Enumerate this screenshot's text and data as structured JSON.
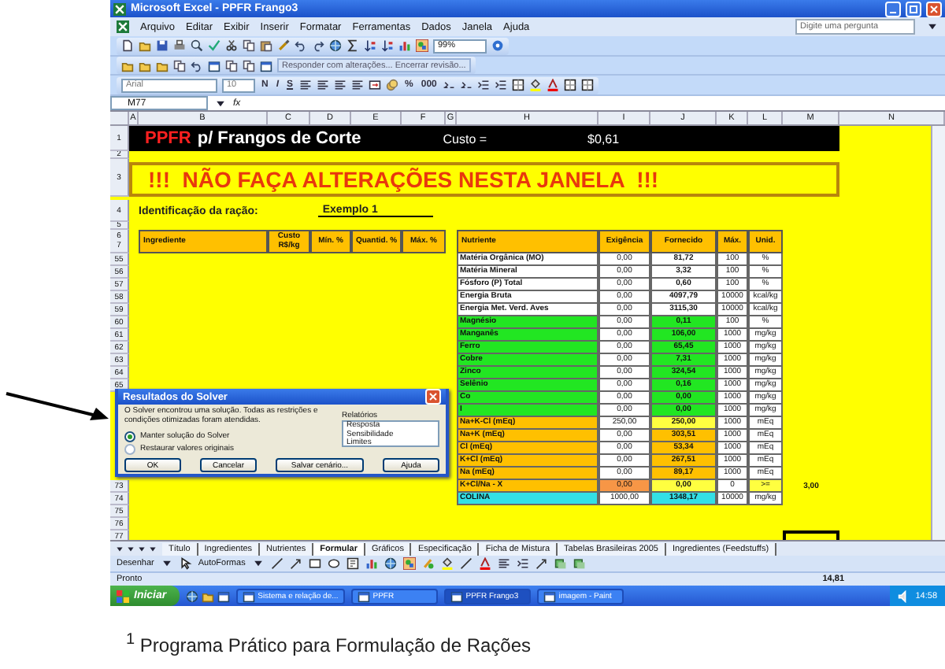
{
  "window": {
    "title": "Microsoft Excel - PPFR Frango3"
  },
  "menu": [
    "Arquivo",
    "Editar",
    "Exibir",
    "Inserir",
    "Formatar",
    "Ferramentas",
    "Dados",
    "Janela",
    "Ajuda"
  ],
  "help_box": {
    "placeholder": "Digite uma pergunta"
  },
  "standard_toolbar": {
    "zoom": "99%"
  },
  "review_toolbar": {
    "text": "Responder com alterações...   Encerrar revisão..."
  },
  "format_toolbar": {
    "font": "Arial",
    "size": "10",
    "style_buttons": [
      "N",
      "I",
      "S"
    ],
    "number_buttons": [
      "%",
      "000"
    ]
  },
  "formula_bar": {
    "name_box": "M77",
    "fx": "fx"
  },
  "columns": [
    "A",
    "B",
    "C",
    "D",
    "E",
    "F",
    "G",
    "H",
    "I",
    "J",
    "K",
    "L",
    "M",
    "N"
  ],
  "sheet": {
    "row_numbers": {
      "title": "1",
      "spacer1": "2",
      "warning": "3",
      "id": "4",
      "spacer2": "5",
      "header": [
        "6",
        "7"
      ]
    },
    "title_brand": "PPFR",
    "title_rest": "p/ Frangos de Corte",
    "cost_label": "Custo =",
    "cost_value": "$0,61",
    "warning": "!!!  NÃO FAÇA ALTERAÇÕES NESTA JANELA  !!!",
    "id_label": "Identificação da ração:",
    "id_value": "Exemplo 1",
    "ingredient_headers": [
      "Ingrediente",
      "Custo R$/kg",
      "Mín. %",
      "Quantid. %",
      "Máx. %"
    ],
    "nutrient_headers": [
      "Nutriente",
      "Exigência",
      "Fornecido",
      "Máx.",
      "Unid."
    ],
    "rows": [
      {
        "row": "55",
        "nutrient": "Matéria Orgânica (MO)",
        "required": "0,00",
        "supplied": "81,72",
        "max": "100",
        "unit": "%",
        "kind": "basic"
      },
      {
        "row": "56",
        "nutrient": "Matéria Mineral",
        "required": "0,00",
        "supplied": "3,32",
        "max": "100",
        "unit": "%",
        "kind": "basic"
      },
      {
        "row": "57",
        "nutrient": "Fósforo (P) Total",
        "required": "0,00",
        "supplied": "0,60",
        "max": "100",
        "unit": "%",
        "kind": "basic"
      },
      {
        "row": "58",
        "nutrient": "Energia Bruta",
        "required": "0,00",
        "supplied": "4097,79",
        "max": "10000",
        "unit": "kcal/kg",
        "kind": "basic"
      },
      {
        "row": "59",
        "nutrient": "Energia Met. Verd. Aves",
        "required": "0,00",
        "supplied": "3115,30",
        "max": "10000",
        "unit": "kcal/kg",
        "kind": "basic"
      },
      {
        "row": "60",
        "nutrient": "Magnésio",
        "required": "0,00",
        "supplied": "0,11",
        "max": "100",
        "unit": "%",
        "kind": "mineral"
      },
      {
        "row": "61",
        "nutrient": "Manganês",
        "required": "0,00",
        "supplied": "106,00",
        "max": "1000",
        "unit": "mg/kg",
        "kind": "mineral"
      },
      {
        "row": "62",
        "nutrient": "Ferro",
        "required": "0,00",
        "supplied": "65,45",
        "max": "1000",
        "unit": "mg/kg",
        "kind": "mineral"
      },
      {
        "row": "63",
        "nutrient": "Cobre",
        "required": "0,00",
        "supplied": "7,31",
        "max": "1000",
        "unit": "mg/kg",
        "kind": "mineral"
      },
      {
        "row": "64",
        "nutrient": "Zinco",
        "required": "0,00",
        "supplied": "324,54",
        "max": "1000",
        "unit": "mg/kg",
        "kind": "mineral"
      },
      {
        "row": "65",
        "nutrient": "Selênio",
        "required": "0,00",
        "supplied": "0,16",
        "max": "1000",
        "unit": "mg/kg",
        "kind": "mineral"
      },
      {
        "nutrient": "Co",
        "required": "0,00",
        "supplied": "0,00",
        "max": "1000",
        "unit": "mg/kg",
        "kind": "mineral"
      },
      {
        "nutrient": "I",
        "required": "0,00",
        "supplied": "0,00",
        "max": "1000",
        "unit": "mg/kg",
        "kind": "mineral"
      },
      {
        "nutrient": "Na+K-Cl (mEq)",
        "required": "250,00",
        "supplied": "250,00",
        "max": "1000",
        "unit": "mEq",
        "kind": "balance"
      },
      {
        "nutrient": "Na+K (mEq)",
        "required": "0,00",
        "supplied": "303,51",
        "max": "1000",
        "unit": "mEq",
        "kind": "electrolyte"
      },
      {
        "nutrient": "Cl (mEq)",
        "required": "0,00",
        "supplied": "53,34",
        "max": "1000",
        "unit": "mEq",
        "kind": "electrolyte"
      },
      {
        "nutrient": "K+Cl (mEq)",
        "required": "0,00",
        "supplied": "267,51",
        "max": "1000",
        "unit": "mEq",
        "kind": "electrolyte"
      },
      {
        "nutrient": "Na (mEq)",
        "required": "0,00",
        "supplied": "89,17",
        "max": "1000",
        "unit": "mEq",
        "kind": "electrolyte"
      },
      {
        "row": "73",
        "nutrient": "K+Cl/Na - X",
        "required": "0,00",
        "supplied": "0,00",
        "max": "0",
        "unit": ">=",
        "target": "3,00",
        "kind": "ratio"
      },
      {
        "row": "74",
        "nutrient": "COLINA",
        "required": "1000,00",
        "supplied": "1348,17",
        "max": "10000",
        "unit": "mg/kg",
        "kind": "total"
      }
    ],
    "trailing_rows": [
      {
        "row": "75",
        "selected": false
      },
      {
        "row": "76",
        "selected": false
      },
      {
        "row": "77",
        "selected": true
      }
    ]
  },
  "dialog": {
    "title": "Resultados do Solver",
    "message": "O Solver encontrou uma solução. Todas as restrições e condições otimizadas foram atendidas.",
    "reports_label": "Relatórios",
    "reports": [
      "Resposta",
      "Sensibilidade",
      "Limites"
    ],
    "options": [
      {
        "label": "Manter solução do Solver",
        "selected": true
      },
      {
        "label": "Restaurar valores originais",
        "selected": false
      }
    ],
    "buttons": [
      "OK",
      "Cancelar",
      "Salvar cenário...",
      "Ajuda"
    ]
  },
  "sheet_tabs": [
    {
      "label": "Título",
      "selected": false
    },
    {
      "label": "Ingredientes",
      "selected": false
    },
    {
      "label": "Nutrientes",
      "selected": false
    },
    {
      "label": "Formular",
      "selected": true
    },
    {
      "label": "Gráficos",
      "selected": false
    },
    {
      "label": "Especificação",
      "selected": false
    },
    {
      "label": "Ficha de Mistura",
      "selected": false
    },
    {
      "label": "Tabelas Brasileiras 2005",
      "selected": false
    },
    {
      "label": "Ingredientes (Feedstuffs)",
      "selected": false
    }
  ],
  "drawing_toolbar": {
    "draw": "Desenhar",
    "autoshapes": "AutoFormas"
  },
  "status_bar": {
    "status": "Pronto",
    "value": "14,81"
  },
  "taskbar": {
    "start": "Iniciar",
    "tasks": [
      {
        "label": "Sistema e relação de...",
        "selected": false
      },
      {
        "label": "PPFR",
        "selected": false
      },
      {
        "label": "PPFR Frango3",
        "selected": true
      },
      {
        "label": "imagem - Paint",
        "selected": false
      }
    ],
    "clock": "14:58"
  },
  "caption": "$^{1}$ Programa Prático para Formulação de Rações"
}
